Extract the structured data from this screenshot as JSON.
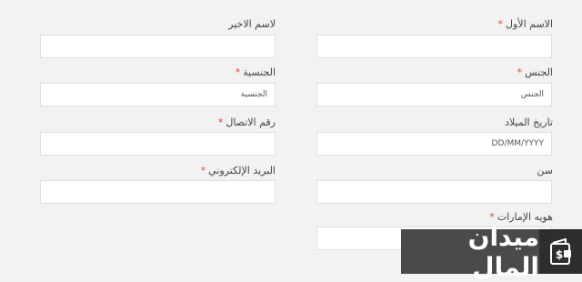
{
  "form": {
    "first_name": {
      "label": "الاسم الأول",
      "required": "*"
    },
    "last_name": {
      "label": "لاسم الاخير"
    },
    "gender": {
      "label": "الجنس",
      "required": "*",
      "placeholder": "الجنس"
    },
    "nationality": {
      "label": "الجنسية",
      "required": "*",
      "placeholder": "الجنسية"
    },
    "birth_date": {
      "label": "تاريخ الميلاد",
      "placeholder": "DD/MM/YYYY"
    },
    "phone": {
      "label": "رقم الاتصال",
      "required": "*"
    },
    "age": {
      "label": "سن"
    },
    "email": {
      "label": "البريد الإلكتروني",
      "required": "*"
    },
    "emirates_id": {
      "label": "هويه الإمارات",
      "required": "*"
    }
  },
  "watermark": {
    "text": "ميدان المال",
    "icon": "wallet-currency-icon"
  },
  "colors": {
    "required": "#e2463c",
    "watermark_bg": "#4a4a4a"
  }
}
